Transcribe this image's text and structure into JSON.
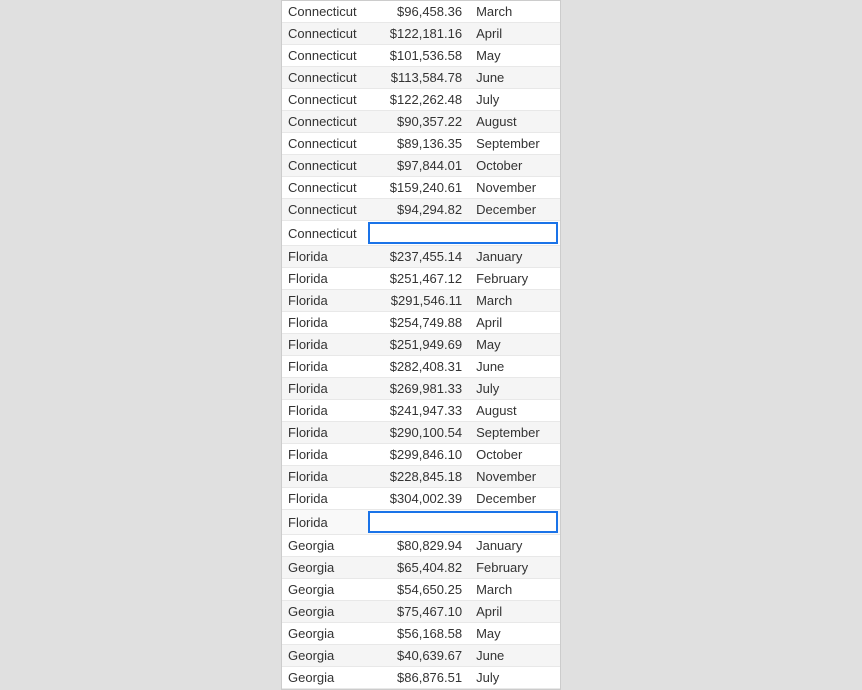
{
  "table": {
    "rows": [
      {
        "state": "Connecticut",
        "amount": "$96,458.36",
        "month": "March",
        "highlighted": false,
        "inputRow": false
      },
      {
        "state": "Connecticut",
        "amount": "$122,181.16",
        "month": "April",
        "highlighted": false,
        "inputRow": false
      },
      {
        "state": "Connecticut",
        "amount": "$101,536.58",
        "month": "May",
        "highlighted": false,
        "inputRow": false
      },
      {
        "state": "Connecticut",
        "amount": "$113,584.78",
        "month": "June",
        "highlighted": false,
        "inputRow": false
      },
      {
        "state": "Connecticut",
        "amount": "$122,262.48",
        "month": "July",
        "highlighted": false,
        "inputRow": false
      },
      {
        "state": "Connecticut",
        "amount": "$90,357.22",
        "month": "August",
        "highlighted": false,
        "inputRow": false
      },
      {
        "state": "Connecticut",
        "amount": "$89,136.35",
        "month": "September",
        "highlighted": false,
        "inputRow": false
      },
      {
        "state": "Connecticut",
        "amount": "$97,844.01",
        "month": "October",
        "highlighted": false,
        "inputRow": false
      },
      {
        "state": "Connecticut",
        "amount": "$159,240.61",
        "month": "November",
        "highlighted": false,
        "inputRow": false
      },
      {
        "state": "Connecticut",
        "amount": "$94,294.82",
        "month": "December",
        "highlighted": false,
        "inputRow": false
      },
      {
        "state": "Connecticut",
        "amount": "",
        "month": "",
        "highlighted": true,
        "inputRow": true
      },
      {
        "state": "Florida",
        "amount": "$237,455.14",
        "month": "January",
        "highlighted": false,
        "inputRow": false
      },
      {
        "state": "Florida",
        "amount": "$251,467.12",
        "month": "February",
        "highlighted": false,
        "inputRow": false
      },
      {
        "state": "Florida",
        "amount": "$291,546.11",
        "month": "March",
        "highlighted": false,
        "inputRow": false
      },
      {
        "state": "Florida",
        "amount": "$254,749.88",
        "month": "April",
        "highlighted": false,
        "inputRow": false
      },
      {
        "state": "Florida",
        "amount": "$251,949.69",
        "month": "May",
        "highlighted": false,
        "inputRow": false
      },
      {
        "state": "Florida",
        "amount": "$282,408.31",
        "month": "June",
        "highlighted": false,
        "inputRow": false
      },
      {
        "state": "Florida",
        "amount": "$269,981.33",
        "month": "July",
        "highlighted": false,
        "inputRow": false
      },
      {
        "state": "Florida",
        "amount": "$241,947.33",
        "month": "August",
        "highlighted": false,
        "inputRow": false
      },
      {
        "state": "Florida",
        "amount": "$290,100.54",
        "month": "September",
        "highlighted": false,
        "inputRow": false
      },
      {
        "state": "Florida",
        "amount": "$299,846.10",
        "month": "October",
        "highlighted": false,
        "inputRow": false
      },
      {
        "state": "Florida",
        "amount": "$228,845.18",
        "month": "November",
        "highlighted": false,
        "inputRow": false
      },
      {
        "state": "Florida",
        "amount": "$304,002.39",
        "month": "December",
        "highlighted": false,
        "inputRow": false
      },
      {
        "state": "Florida",
        "amount": "",
        "month": "",
        "highlighted": true,
        "inputRow": true
      },
      {
        "state": "Georgia",
        "amount": "$80,829.94",
        "month": "January",
        "highlighted": false,
        "inputRow": false
      },
      {
        "state": "Georgia",
        "amount": "$65,404.82",
        "month": "February",
        "highlighted": false,
        "inputRow": false
      },
      {
        "state": "Georgia",
        "amount": "$54,650.25",
        "month": "March",
        "highlighted": false,
        "inputRow": false
      },
      {
        "state": "Georgia",
        "amount": "$75,467.10",
        "month": "April",
        "highlighted": false,
        "inputRow": false
      },
      {
        "state": "Georgia",
        "amount": "$56,168.58",
        "month": "May",
        "highlighted": false,
        "inputRow": false
      },
      {
        "state": "Georgia",
        "amount": "$40,639.67",
        "month": "June",
        "highlighted": false,
        "inputRow": false
      },
      {
        "state": "Georgia",
        "amount": "$86,876.51",
        "month": "July",
        "highlighted": false,
        "inputRow": false
      }
    ]
  }
}
